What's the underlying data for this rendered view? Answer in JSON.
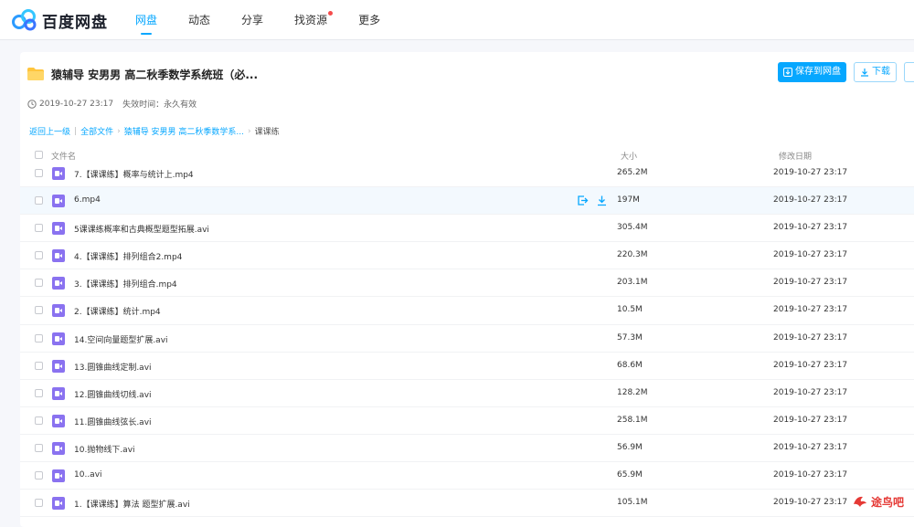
{
  "brand": {
    "name": "百度网盘",
    "accent": "#06a7ff"
  },
  "nav": {
    "items": [
      {
        "label": "网盘",
        "active": true
      },
      {
        "label": "动态"
      },
      {
        "label": "分享"
      },
      {
        "label": "找资源",
        "badge": true
      },
      {
        "label": "更多"
      }
    ]
  },
  "share": {
    "title": "猿辅导 安男男 高二秋季数学系统班（必...",
    "save_label": "保存到网盘",
    "download_label": "下载",
    "created": "2019-10-27 23:17",
    "expiry": "失效时间：永久有效"
  },
  "breadcrumb": {
    "back": "返回上一级",
    "all": "全部文件",
    "folder": "猿辅导 安男男 高二秋季数学系...",
    "current": "课课练"
  },
  "table": {
    "headers": {
      "name": "文件名",
      "size": "大小",
      "date": "修改日期"
    },
    "rows": [
      {
        "name": "7.【课课练】概率与统计上.mp4",
        "size": "265.2M",
        "date": "2019-10-27 23:17"
      },
      {
        "name": "6.mp4",
        "size": "197M",
        "date": "2019-10-27 23:17"
      },
      {
        "name": "5课课练概率和古典概型题型拓展.avi",
        "size": "305.4M",
        "date": "2019-10-27 23:17"
      },
      {
        "name": "4.【课课练】排列组合2.mp4",
        "size": "220.3M",
        "date": "2019-10-27 23:17"
      },
      {
        "name": "3.【课课练】排列组合.mp4",
        "size": "203.1M",
        "date": "2019-10-27 23:17"
      },
      {
        "name": "2.【课课练】统计.mp4",
        "size": "10.5M",
        "date": "2019-10-27 23:17"
      },
      {
        "name": "14.空间向量题型扩展.avi",
        "size": "57.3M",
        "date": "2019-10-27 23:17"
      },
      {
        "name": "13.圆锥曲线定制.avi",
        "size": "68.6M",
        "date": "2019-10-27 23:17"
      },
      {
        "name": "12.圆锥曲线切线.avi",
        "size": "128.2M",
        "date": "2019-10-27 23:17"
      },
      {
        "name": "11.圆锥曲线弦长.avi",
        "size": "258.1M",
        "date": "2019-10-27 23:17"
      },
      {
        "name": "10.抛物线下.avi",
        "size": "56.9M",
        "date": "2019-10-27 23:17"
      },
      {
        "name": "10..avi",
        "size": "65.9M",
        "date": "2019-10-27 23:17"
      },
      {
        "name": "1.【课课练】算法 题型扩展.avi",
        "size": "105.1M",
        "date": "2019-10-27 23:17"
      }
    ],
    "hover_row": 1
  },
  "watermark": {
    "text": "途鸟吧"
  }
}
